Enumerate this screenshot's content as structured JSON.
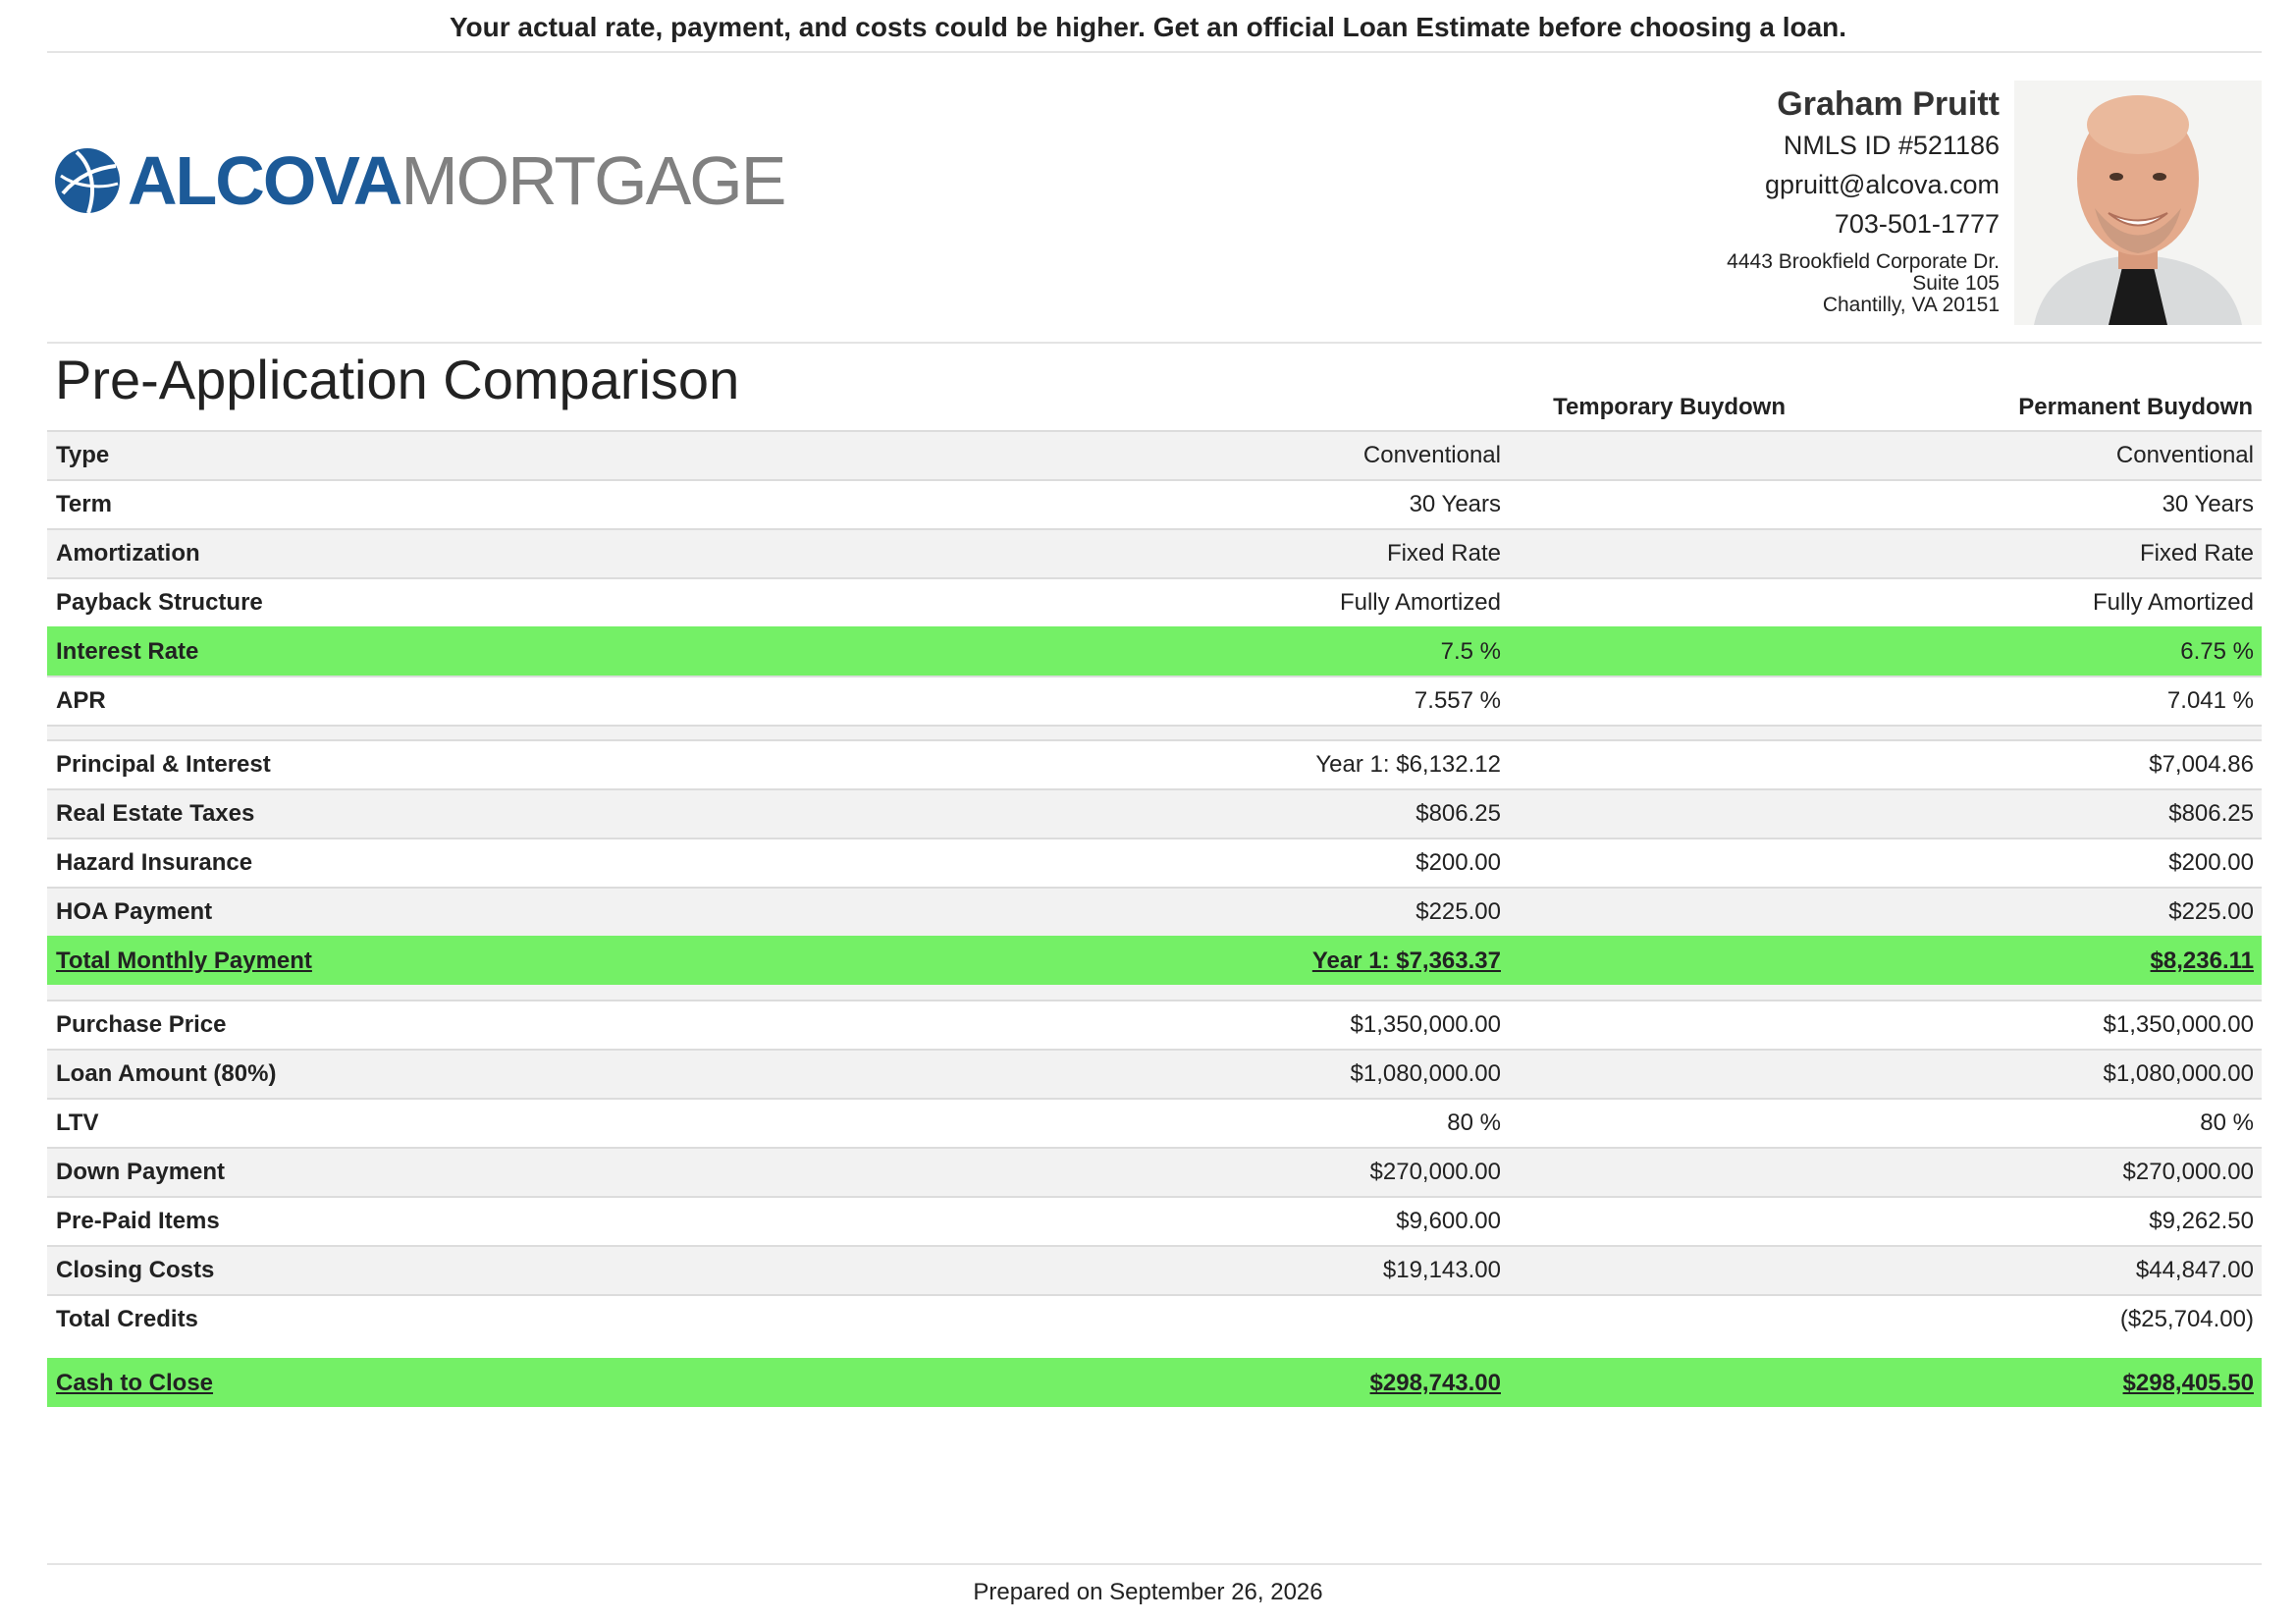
{
  "disclaimer": "Your actual rate, payment, and costs could be higher. Get an official Loan Estimate before choosing a loan.",
  "logo": {
    "brand_bold": "ALCOVA",
    "brand_light": "MORTGAGE",
    "icon": "globe-icon",
    "color_primary": "#1c5a98",
    "color_secondary": "#808080"
  },
  "contact": {
    "name": "Graham Pruitt",
    "nmls": "NMLS ID #521186",
    "email": "gpruitt@alcova.com",
    "phone": "703-501-1777",
    "address_line1": "4443 Brookfield Corporate Dr.",
    "address_line2": "Suite 105",
    "address_line3": "Chantilly, VA 20151"
  },
  "title": "Pre-Application Comparison",
  "columns": [
    "Temporary Buydown",
    "Permanent Buydown"
  ],
  "colors": {
    "highlight": "#74f066",
    "alt_row": "#f2f2f2"
  },
  "loan_terms": [
    {
      "label": "Type",
      "v1": "Conventional",
      "v2": "Conventional"
    },
    {
      "label": "Term",
      "v1": "30 Years",
      "v2": "30 Years"
    },
    {
      "label": "Amortization",
      "v1": "Fixed Rate",
      "v2": "Fixed Rate"
    },
    {
      "label": "Payback Structure",
      "v1": "Fully Amortized",
      "v2": "Fully Amortized"
    },
    {
      "label": "Interest Rate",
      "v1": "7.5 %",
      "v2": "6.75 %"
    },
    {
      "label": "APR",
      "v1": "7.557 %",
      "v2": "7.041 %"
    }
  ],
  "payments": [
    {
      "label": "Principal & Interest",
      "v1": "Year 1: $6,132.12",
      "v2": "$7,004.86"
    },
    {
      "label": "Real Estate Taxes",
      "v1": "$806.25",
      "v2": "$806.25"
    },
    {
      "label": "Hazard Insurance",
      "v1": "$200.00",
      "v2": "$200.00"
    },
    {
      "label": "HOA Payment",
      "v1": "$225.00",
      "v2": "$225.00"
    },
    {
      "label": "Total Monthly Payment",
      "v1": "Year 1: $7,363.37",
      "v2": "$8,236.11"
    }
  ],
  "costs": [
    {
      "label": "Purchase Price",
      "v1": "$1,350,000.00",
      "v2": "$1,350,000.00"
    },
    {
      "label": "Loan Amount (80%)",
      "v1": "$1,080,000.00",
      "v2": "$1,080,000.00"
    },
    {
      "label": "LTV",
      "v1": "80 %",
      "v2": "80 %"
    },
    {
      "label": "Down Payment",
      "v1": "$270,000.00",
      "v2": "$270,000.00"
    },
    {
      "label": "Pre-Paid Items",
      "v1": "$9,600.00",
      "v2": "$9,262.50"
    },
    {
      "label": "Closing Costs",
      "v1": "$19,143.00",
      "v2": "$44,847.00"
    },
    {
      "label": "Total Credits",
      "v1": "",
      "v2": "($25,704.00)"
    }
  ],
  "cash_to_close": {
    "label": "Cash to Close",
    "v1": "$298,743.00",
    "v2": "$298,405.50"
  },
  "footer": "Prepared on September 26, 2026"
}
